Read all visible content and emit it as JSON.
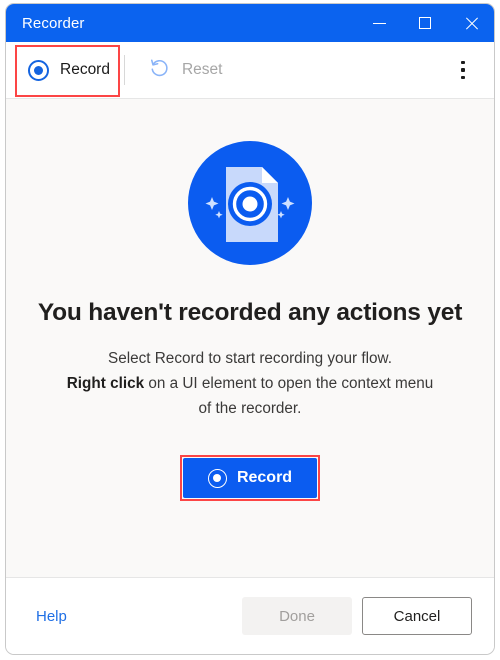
{
  "window": {
    "title": "Recorder",
    "controls": [
      {
        "name": "minimize-button",
        "label": "Minimize"
      },
      {
        "name": "maximize-button",
        "label": "Maximize"
      },
      {
        "name": "close-button",
        "label": "Close"
      }
    ]
  },
  "toolbar": {
    "record_label": "Record",
    "record_icon": "record-circle-icon",
    "reset_label": "Reset",
    "reset_icon": "undo-arrow-icon",
    "reset_disabled": true,
    "overflow_icon": "kebab-menu-icon"
  },
  "content": {
    "illustration_icon": "document-record-illustration",
    "headline": "You haven't recorded any actions yet",
    "body_line1": "Select Record to start recording your flow.",
    "body_line2_bold": "Right click",
    "body_line2_rest": " on a UI element to open the context menu of the recorder.",
    "primary_button_label": "Record",
    "primary_button_icon": "record-circle-icon"
  },
  "footer": {
    "help_label": "Help",
    "done_label": "Done",
    "done_disabled": true,
    "cancel_label": "Cancel"
  },
  "colors": {
    "titlebar_blue": "#0b63ef",
    "primary_blue": "#0b5cf0",
    "icon_blue": "#1464e0",
    "annotation_red": "#fc4545",
    "link_blue": "#1f6fe5",
    "content_bg": "#faf9f8",
    "disabled_text": "#a19f9d"
  }
}
